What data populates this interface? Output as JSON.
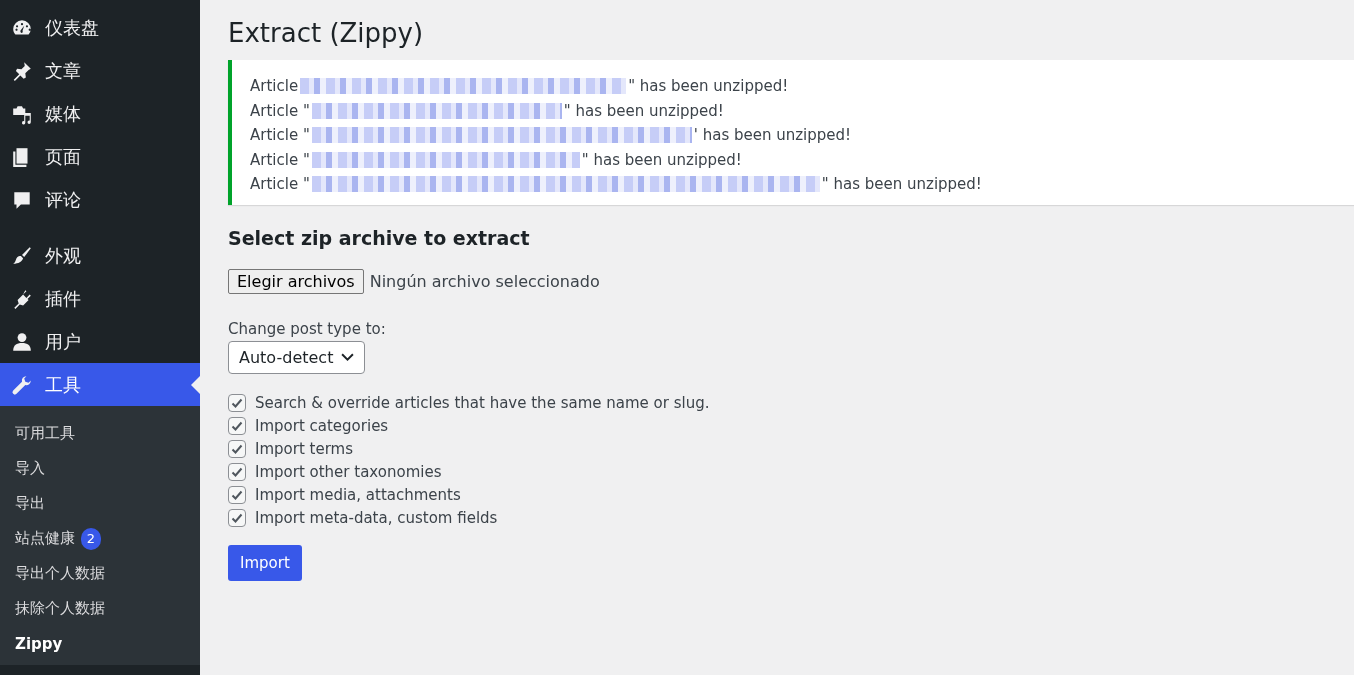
{
  "sidebar": {
    "menu": [
      {
        "label": "仪表盘",
        "selected": false
      },
      {
        "label": "文章",
        "selected": false
      },
      {
        "label": "媒体",
        "selected": false
      },
      {
        "label": "页面",
        "selected": false
      },
      {
        "label": "评论",
        "selected": false
      },
      {
        "label": "外观",
        "selected": false
      },
      {
        "label": "插件",
        "selected": false
      },
      {
        "label": "用户",
        "selected": false
      },
      {
        "label": "工具",
        "selected": true,
        "submenu": [
          {
            "label": "可用工具",
            "selected": false
          },
          {
            "label": "导入",
            "selected": false
          },
          {
            "label": "导出",
            "selected": false
          },
          {
            "label": "站点健康",
            "selected": false,
            "badge": "2"
          },
          {
            "label": "导出个人数据",
            "selected": false
          },
          {
            "label": "抹除个人数据",
            "selected": false
          },
          {
            "label": "Zippy",
            "selected": true
          }
        ]
      }
    ]
  },
  "page": {
    "title": "Extract (Zippy)",
    "notice": {
      "messages": [
        {
          "prefix": "Article",
          "suffix": "\" has been unzipped!"
        },
        {
          "prefix": "Article \"",
          "suffix": "\" has been unzipped!"
        },
        {
          "prefix": "Article \"",
          "suffix": "' has been unzipped!"
        },
        {
          "prefix": "Article \"",
          "suffix": "\" has been unzipped!"
        },
        {
          "prefix": "Article \"",
          "suffix": "\" has been unzipped!"
        }
      ]
    },
    "form": {
      "heading": "Select zip archive to extract",
      "file_button": "Elegir archivos",
      "file_status": "Ningún archivo seleccionado",
      "post_type_label": "Change post type to:",
      "post_type_value": "Auto-detect",
      "options": [
        {
          "label": "Search & override articles that have the same name or slug.",
          "checked": true
        },
        {
          "label": "Import categories",
          "checked": true
        },
        {
          "label": "Import terms",
          "checked": true
        },
        {
          "label": "Import other taxonomies",
          "checked": true
        },
        {
          "label": "Import media, attachments",
          "checked": true
        },
        {
          "label": "Import meta-data, custom fields",
          "checked": true
        }
      ],
      "submit": "Import"
    }
  }
}
